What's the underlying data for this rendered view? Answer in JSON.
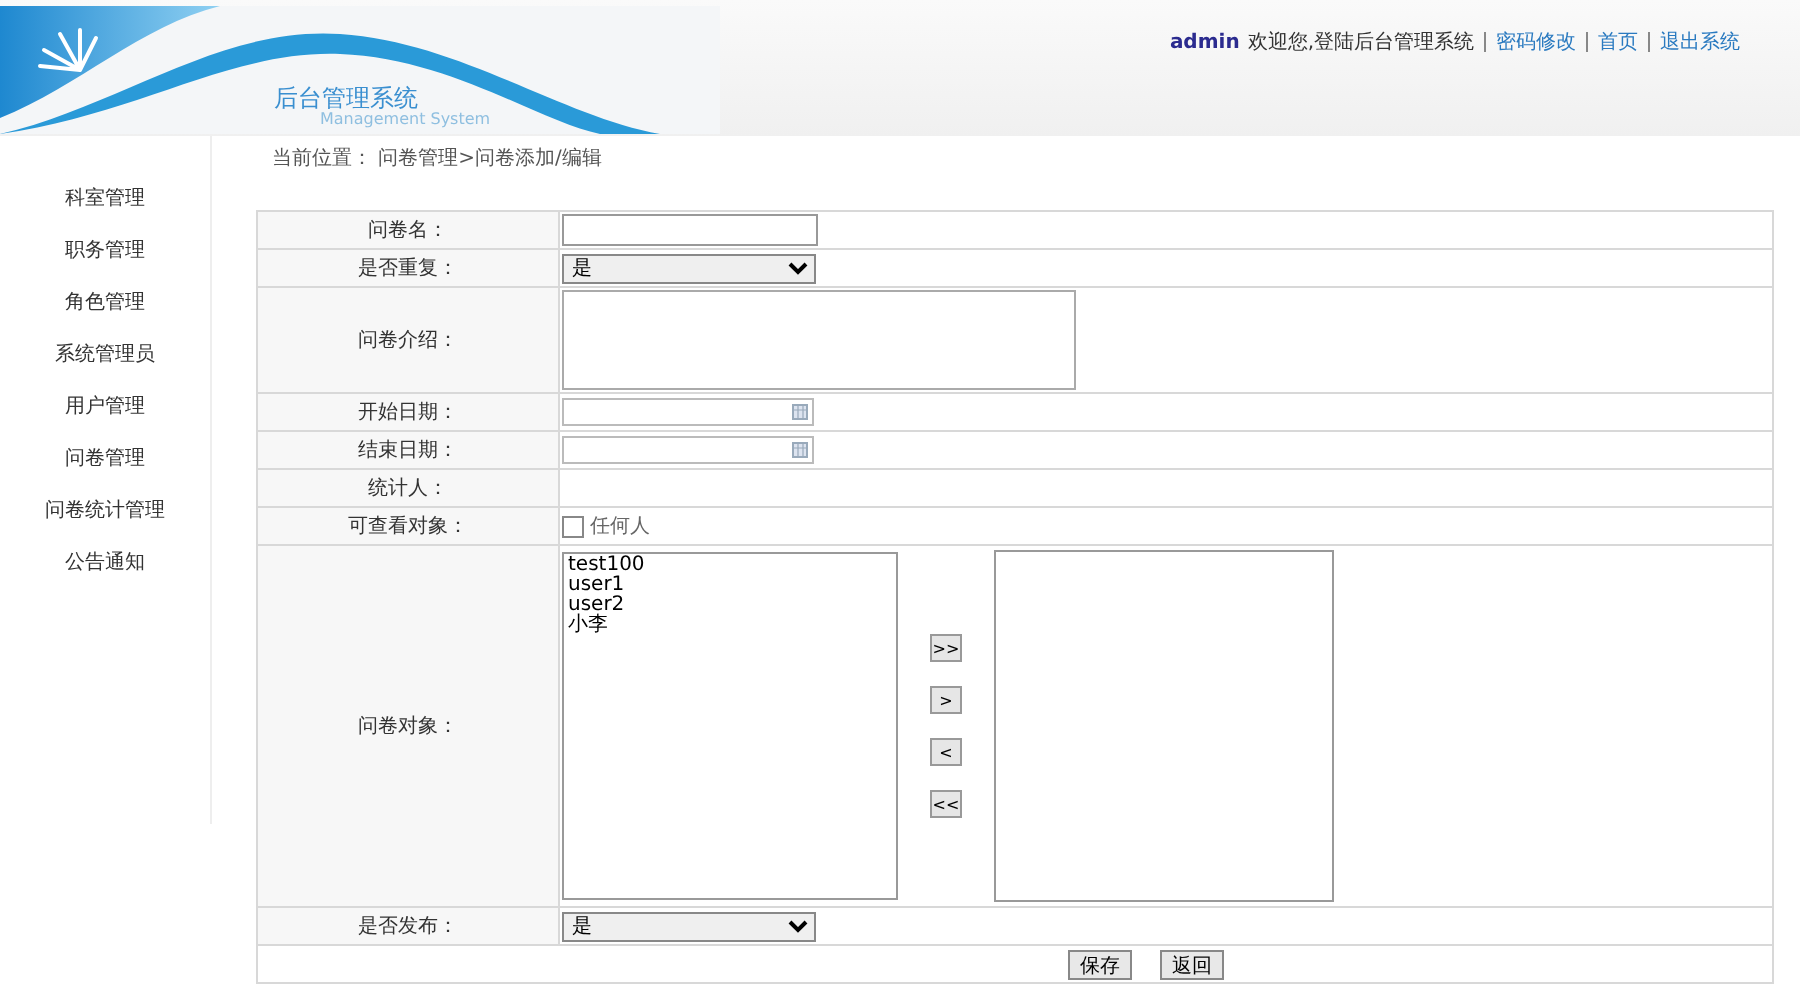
{
  "header": {
    "logo_title": "后台管理系统",
    "logo_subtitle": "Management System",
    "user": "admin",
    "welcome": "欢迎您,登陆后台管理系统",
    "links": [
      "密码修改",
      "首页",
      "退出系统"
    ]
  },
  "sidebar": {
    "items": [
      {
        "label": "科室管理"
      },
      {
        "label": "职务管理"
      },
      {
        "label": "角色管理"
      },
      {
        "label": "系统管理员"
      },
      {
        "label": "用户管理"
      },
      {
        "label": "问卷管理"
      },
      {
        "label": "问卷统计管理"
      },
      {
        "label": "公告通知"
      }
    ]
  },
  "breadcrumb": "当前位置： 问卷管理>问卷添加/编辑",
  "form": {
    "rows": [
      {
        "kind": "text",
        "label": "问卷名："
      },
      {
        "kind": "select",
        "label": "是否重复：",
        "value": "是"
      },
      {
        "kind": "textarea",
        "label": "问卷介绍："
      },
      {
        "kind": "date",
        "label": "开始日期："
      },
      {
        "kind": "date",
        "label": "结束日期："
      },
      {
        "kind": "blank",
        "label": "统计人："
      },
      {
        "kind": "checkbox",
        "label": "可查看对象：",
        "option": "任何人",
        "checked": false
      },
      {
        "kind": "transfer",
        "label": "问卷对象：",
        "available": [
          "test100",
          "user1",
          "user2",
          "小李"
        ],
        "buttons": [
          ">>",
          ">",
          "<",
          "<<"
        ]
      },
      {
        "kind": "select",
        "label": "是否发布：",
        "value": "是"
      }
    ],
    "buttons": [
      "保存",
      "返回"
    ]
  }
}
